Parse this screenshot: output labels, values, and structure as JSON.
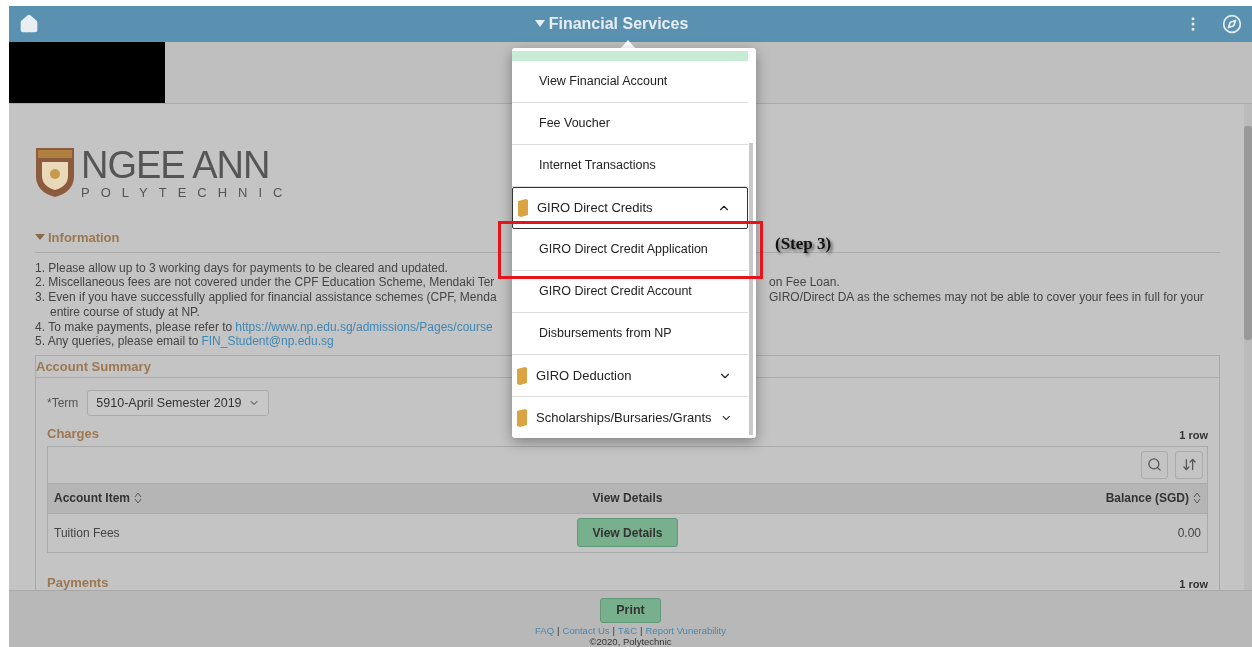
{
  "header": {
    "title": "Financial Services"
  },
  "menu": {
    "items": [
      {
        "kind": "link",
        "label": "View Financial Account"
      },
      {
        "kind": "link",
        "label": "Fee Voucher"
      },
      {
        "kind": "link",
        "label": "Internet Transactions"
      },
      {
        "kind": "folder",
        "label": "GIRO Direct Credits",
        "expanded": true,
        "children": [
          {
            "kind": "link",
            "label": "GIRO Direct Credit Application"
          },
          {
            "kind": "link",
            "label": "GIRO Direct Credit Account"
          },
          {
            "kind": "link",
            "label": "Disbursements from NP"
          }
        ]
      },
      {
        "kind": "folder",
        "label": "GIRO Deduction",
        "expanded": false
      },
      {
        "kind": "folder",
        "label": "Scholarships/Bursaries/Grants",
        "expanded": false
      }
    ]
  },
  "annotation": {
    "label": "(Step 3)"
  },
  "logo": {
    "name": "NGEE ANN",
    "subtitle": "POLYTECHNIC"
  },
  "information": {
    "title": "Information",
    "expanded": true,
    "lines": [
      {
        "text": "1. Please allow up to 3 working days for payments to be cleared and updated."
      },
      {
        "text": "2. Miscellaneous fees are not covered under the CPF Education Scheme, Mendaki Ter",
        "after_menu": "on Fee Loan."
      },
      {
        "text": "3. Even if you have successfully applied for financial assistance schemes (CPF, Menda",
        "after_menu": "GIRO/Direct DA as the schemes may not be able to cover your fees in full for your",
        "wrap": "entire course of study at NP."
      },
      {
        "text": "4. To make payments, please refer to",
        "link": "https://www.np.edu.sg/admissions/Pages/course"
      },
      {
        "text": "5. Any queries, please email to",
        "link": "FIN_Student@np.edu.sg"
      }
    ]
  },
  "account_summary": {
    "title": "Account Summary",
    "term_label": "*Term",
    "term_value": "5910-April Semester 2019",
    "charges": {
      "title": "Charges",
      "row_count": "1 row",
      "columns": [
        "Account Item",
        "View Details",
        "Balance (SGD)"
      ],
      "rows": [
        {
          "item": "Tuition Fees",
          "button": "View Details",
          "balance": "0.00"
        }
      ]
    },
    "payments": {
      "title": "Payments",
      "row_count": "1 row"
    }
  },
  "footer": {
    "print": "Print",
    "links": [
      "FAQ",
      "Contact Us",
      "T&C",
      "Report Vunerability"
    ],
    "separator": "|",
    "copyright": "©2020, Polytechnic"
  }
}
